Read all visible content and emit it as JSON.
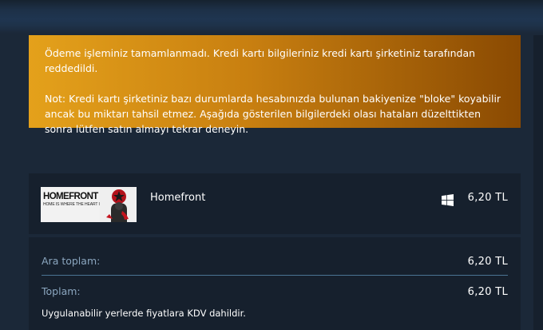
{
  "error": {
    "message": "Ödeme işleminiz tamamlanmadı. Kredi kartı bilgileriniz kredi kartı şirketiniz tarafından reddedildi.",
    "note": "Not: Kredi kartı şirketiniz bazı durumlarda hesabınızda bulunan bakiyenize \"bloke\" koyabilir ancak bu miktarı tahsil etmez. Aşağıda gösterilen bilgilerdeki olası hataları düzelttikten sonra lütfen satın almayı tekrar deneyin."
  },
  "cart": {
    "items": [
      {
        "name": "Homefront",
        "price": "6,20 TL",
        "platform_icon": "windows-icon",
        "thumbnail": {
          "title": "HOMEFRONT",
          "tagline": "HOME IS WHERE THE HEART IS"
        }
      }
    ]
  },
  "totals": {
    "subtotal_label": "Ara toplam:",
    "subtotal_value": "6,20 TL",
    "total_label": "Toplam:",
    "total_value": "6,20 TL",
    "vat_note": "Uygulanabilir yerlerde fiyatlara KDV dahildir."
  },
  "colors": {
    "background": "#1b2838",
    "panel": "#16202d",
    "warning_start": "#e4a11b",
    "warning_end": "#8a4a02",
    "muted_label": "#8ba6bf",
    "divider": "#4b7493"
  }
}
